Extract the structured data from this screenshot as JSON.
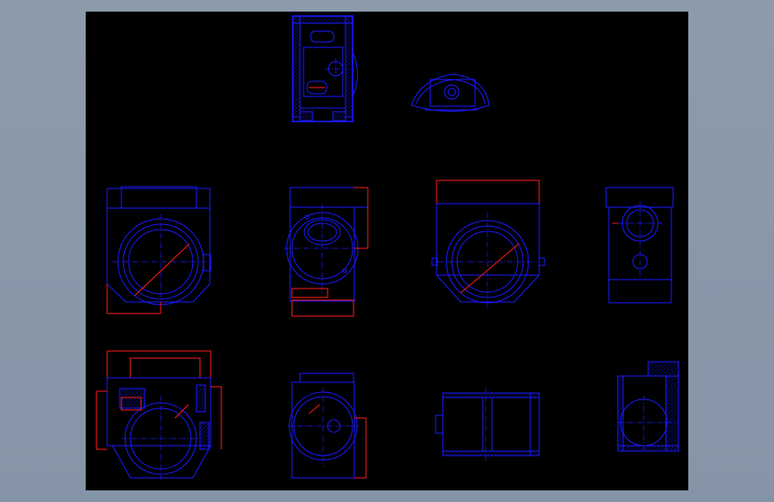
{
  "drawing": {
    "background_color": "#000000",
    "frame_color": "#8d9aab",
    "line_color": "#1a1aff",
    "dimension_color": "#ff1a1a"
  }
}
